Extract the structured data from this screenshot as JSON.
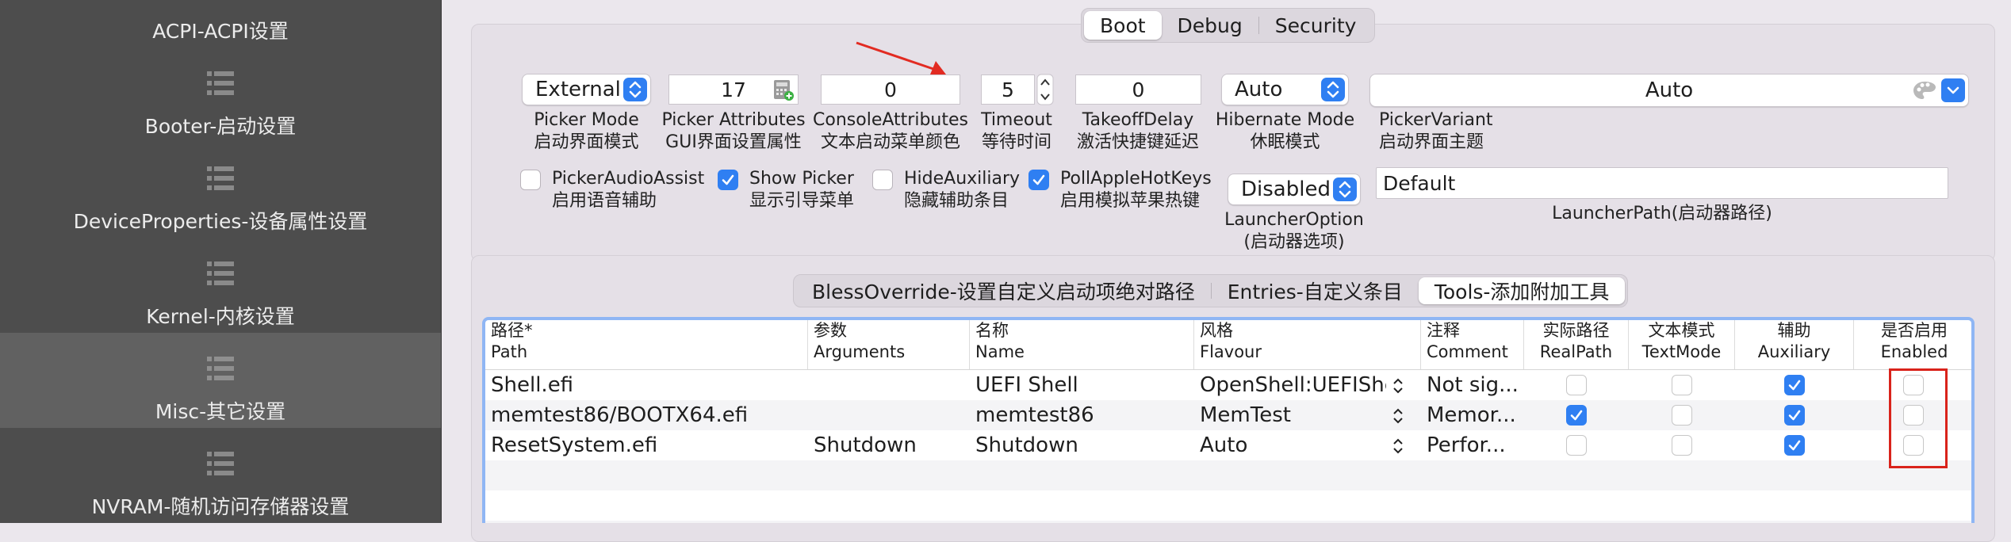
{
  "sidebar": {
    "items": [
      {
        "label": "ACPI-ACPI设置"
      },
      {
        "label": "Booter-启动设置"
      },
      {
        "label": "DeviceProperties-设备属性设置"
      },
      {
        "label": "Kernel-内核设置"
      },
      {
        "label": "Misc-其它设置",
        "selected": true
      },
      {
        "label": "NVRAM-随机访问存储器设置"
      }
    ]
  },
  "top_tabs": {
    "items": [
      "Boot",
      "Debug",
      "Security"
    ],
    "active": "Boot"
  },
  "boot": {
    "picker_mode": {
      "value": "External",
      "label1": "Picker Mode",
      "label2": "启动界面模式"
    },
    "picker_attributes": {
      "value": "17",
      "label1": "Picker Attributes",
      "label2": "GUI界面设置属性"
    },
    "console_attributes": {
      "value": "0",
      "label1": "ConsoleAttributes",
      "label2": "文本启动菜单颜色"
    },
    "timeout": {
      "value": "5",
      "label1": "Timeout",
      "label2": "等待时间"
    },
    "takeoff_delay": {
      "value": "0",
      "label1": "TakeoffDelay",
      "label2": "激活快捷键延迟"
    },
    "hibernate_mode": {
      "value": "Auto",
      "label1": "Hibernate Mode",
      "label2": "休眠模式"
    },
    "picker_variant": {
      "value": "Auto",
      "label1": "PickerVariant",
      "label2": "启动界面主题"
    },
    "checkboxes": [
      {
        "label1": "PickerAudioAssist",
        "label2": "启用语音辅助",
        "checked": false
      },
      {
        "label1": "Show Picker",
        "label2": "显示引导菜单",
        "checked": true
      },
      {
        "label1": "HideAuxiliary",
        "label2": "隐藏辅助条目",
        "checked": false
      },
      {
        "label1": "PollAppleHotKeys",
        "label2": "启用模拟苹果热键",
        "checked": true
      }
    ],
    "launcher_option": {
      "value": "Disabled",
      "label1": "LauncherOption",
      "label2": "(启动器选项)"
    },
    "launcher_path": {
      "value": "Default",
      "label": "LauncherPath(启动器路径)"
    }
  },
  "sub_tabs": {
    "items": [
      "BlessOverride-设置自定义启动项绝对路径",
      "Entries-自定义条目",
      "Tools-添加附加工具"
    ],
    "active": "Tools-添加附加工具"
  },
  "table": {
    "columns": [
      {
        "line1": "路径*",
        "line2": "Path"
      },
      {
        "line1": "参数",
        "line2": "Arguments"
      },
      {
        "line1": "名称",
        "line2": "Name"
      },
      {
        "line1": "风格",
        "line2": "Flavour"
      },
      {
        "line1": "注释",
        "line2": "Comment"
      },
      {
        "line1": "实际路径",
        "line2": "RealPath"
      },
      {
        "line1": "文本模式",
        "line2": "TextMode"
      },
      {
        "line1": "辅助",
        "line2": "Auxiliary"
      },
      {
        "line1": "是否启用",
        "line2": "Enabled"
      }
    ],
    "rows": [
      {
        "path": "Shell.efi",
        "arguments": "",
        "name": "UEFI Shell",
        "flavour": "OpenShell:UEFIShe",
        "comment": "Not sig...",
        "realpath": false,
        "textmode": false,
        "auxiliary": true,
        "enabled": false
      },
      {
        "path": "memtest86/BOOTX64.efi",
        "arguments": "",
        "name": "memtest86",
        "flavour": "MemTest",
        "comment": "Memor...",
        "realpath": true,
        "textmode": false,
        "auxiliary": true,
        "enabled": false
      },
      {
        "path": "ResetSystem.efi",
        "arguments": "Shutdown",
        "name": "Shutdown",
        "flavour": "Auto",
        "comment": "Perfor...",
        "realpath": false,
        "textmode": false,
        "auxiliary": true,
        "enabled": false
      }
    ]
  },
  "colors": {
    "accent": "#2f7ff2",
    "highlight_box": "#d9231b",
    "sidebar_bg": "#4d4d4d",
    "sidebar_selected": "#616161",
    "annotation_arrow": "#e22b22"
  }
}
